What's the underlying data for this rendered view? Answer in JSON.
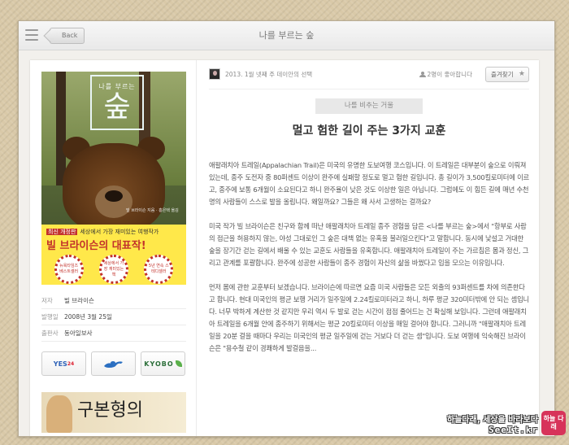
{
  "app": {
    "title": "나를 부르는 숲",
    "back_label": "Back"
  },
  "book": {
    "cover": {
      "small_title": "나를 부르는",
      "big_title": "숲",
      "author_line": "빌 브라이슨 지음 · 홍은택 옮김",
      "band_badge": "최신 개정판",
      "band_line1": "세상에서 가장 재미있는 여행작가",
      "band_line2": "빌 브라이슨의 대표작!",
      "seals": [
        "뉴욕타임즈 베스트셀러",
        "세상에서 가장 재미있는 책",
        "5년 연속 스테디셀러"
      ]
    },
    "meta": [
      {
        "key": "저자",
        "value": "빌 브라이슨"
      },
      {
        "key": "발행일",
        "value": "2008년 3월 25일"
      },
      {
        "key": "출판사",
        "value": "동아일보사"
      }
    ],
    "stores": {
      "yes24": "YES",
      "yes24_sup": "24",
      "kyobo": "KYOBO"
    },
    "next_book_title": "구본형의"
  },
  "article": {
    "selection_label": "2013. 1월 넷째 주 데이안의 선택",
    "likes": "2명이 좋아합니다",
    "favorite_label": "즐겨찾기",
    "category": "나를 비추는 거울",
    "title": "멀고 험한 길이 주는 3가지 교훈",
    "paragraphs": [
      "애팔래치아 트레일(Appalachian Trail)은 미국의 유명한 도보여행 코스입니다. 이 트레일은 대부분이 숲으로 이뤄져 있는데, 종주 도전자 중 80퍼센트 이상이 완주에 실패할 정도로 멀고 험한 길입니다. 총 길이가 3,500킬로미터에 이르고, 종주에 보통 6개월이 소요된다고 하니 완주율이 낮은 것도 이상한 일은 아닙니다. 그럼에도 이 힘든 길에 매년 수천 명의 사람들이 스스로 발을 올립니다. 왜일까요? 그들은 왜 사서 고생하는 걸까요?",
      "미국 작가 빌 브라이슨은 친구와 함께 떠난 애팔래치아 트레일 종주 경험을 담은 <나를 부르는 숲>에서 \"항부로 사람의 접근을 허용하지 않는, 야성 그대로인 그 숲은 대책 없는 유혹을 불러일으킨다\"고 말합니다. 동시에 낯설고 거대한 숲을 장기간 걷는 길에서 배울 수 있는 교훈도 사람들을 유혹합니다. 애팔래치아 트레일이 주는 가르침은 몸과 정신, 그리고 관계를 포괄합니다. 완주에 성공한 사람들이 종주 경험이 자신의 삶을 바꿨다고 입을 모으는 이유입니다.",
      "먼저 몸에 관한 교훈부터 보겠습니다. 브라이슨에 따르면 요즘 미국 사람들은 모든 외출의 93퍼센트를 차에 의존한다고 합니다. 현대 미국인의 평균 보행 거리가 일주일에 2.24킬로미터라고 하니, 하루 평균 320미터밖에 안 되는 셈입니다. 너무 박하게 계산한 것 같지만 우리 역시 두 발로 걷는 시간이 점점 줄어드는 건 확실해 보입니다. 그런데 애팔래치아 트레일을 6개월 안에 종주하기 위해서는 평균 20킬로미터 이상을 매일 걸어야 합니다. 그러니까 \"애팔래치아 트레일을 20분 걸을 때마다 우리는 미국인의 평균 일주일에 걷는 거보다 더 걷는 셈\"입니다. 도보 여행에 익숙해진 브라이슨은 \"용수철 같이 경쾌하게 발걸음을..."
    ]
  },
  "watermark": {
    "line1": "하늘다래, 세상을 바라보다",
    "line2": "SeeIt.kr",
    "logo": "하늘 다래"
  },
  "colors": {
    "accent_red": "#c2312b",
    "band_yellow": "#ffe84a",
    "frame_bg": "#d9c9a8"
  }
}
